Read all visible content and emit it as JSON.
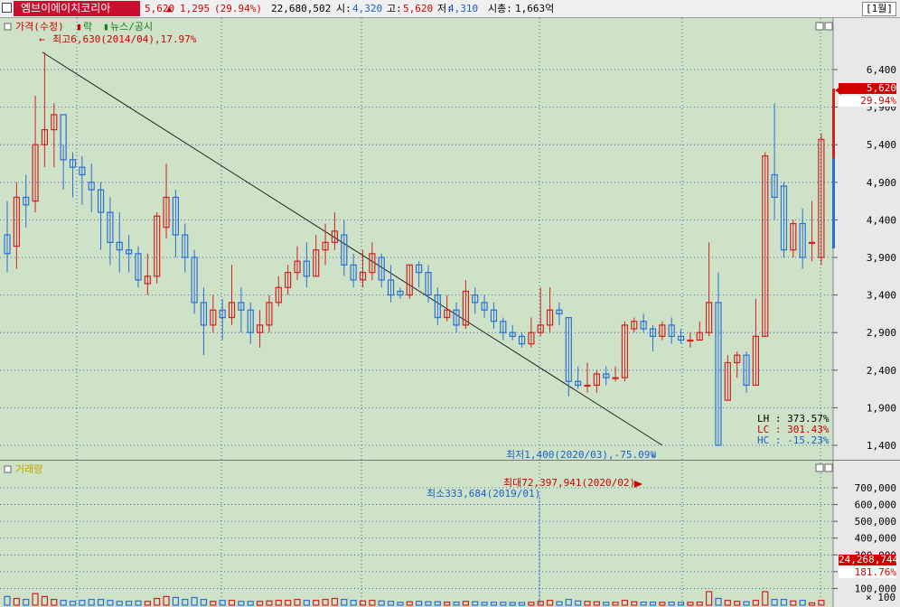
{
  "header": {
    "stock_name": "엠브이에이치코리아",
    "price": "5,620",
    "change": "1,295",
    "change_pct": "(29.94%)",
    "volume": "22,680,502",
    "open_label": "시:",
    "open_value": "4,320",
    "high_label": "고:",
    "high_value": "5,620",
    "low_label": "저:",
    "low_value": "4,310",
    "mcap_label": "시총:",
    "mcap_value": "1,663억",
    "period": "[1월]"
  },
  "price_pane": {
    "legend_price": "가격(수정)",
    "legend_fall": "락",
    "legend_news": "뉴스/공시",
    "max_annotation": "최고6,630(2014/04),17.97%",
    "min_annotation": "최저1,400(2020/03),-75.09%",
    "current_price_label": "5,620",
    "current_pct_label": "29.94%",
    "stats": [
      {
        "key": "LH",
        "value": "373.57%",
        "color": "#000000"
      },
      {
        "key": "LC",
        "value": "301.43%",
        "color": "#d00000"
      },
      {
        "key": "HC",
        "value": "-15.23%",
        "color": "#1a5fd0"
      }
    ]
  },
  "volume_pane": {
    "legend": "거래량",
    "max_annotation": "최대72,397,941(2020/02)",
    "min_annotation": "최소333,684(2019/01)",
    "current_volume_label": "24,268,744",
    "current_pct_label": "181.76%",
    "unit_label": "× 100"
  },
  "colors": {
    "bg": "#cde2c7",
    "up": "#d42020",
    "down": "#2a6fd6",
    "axis_bg": "#e8e8e8"
  },
  "chart_data": {
    "type": "candlestick",
    "y_axis_ticks": [
      "6,400",
      "5,900",
      "5,400",
      "4,900",
      "4,400",
      "3,900",
      "3,400",
      "2,900",
      "2,400",
      "1,900",
      "1,400"
    ],
    "volume_axis_ticks": [
      "700,000",
      "600,000",
      "500,000",
      "400,000",
      "300,000",
      "200,000",
      "100,000"
    ],
    "candles": [
      [
        4200,
        3950,
        4650,
        3700,
        45
      ],
      [
        4050,
        4700,
        4900,
        3750,
        35
      ],
      [
        4700,
        4600,
        5000,
        4300,
        30
      ],
      [
        4650,
        5400,
        6050,
        4500,
        60
      ],
      [
        5400,
        5600,
        6630,
        5100,
        45
      ],
      [
        5600,
        5800,
        5950,
        5100,
        30
      ],
      [
        5800,
        5200,
        5400,
        4800,
        25
      ],
      [
        5200,
        5100,
        5300,
        4700,
        20
      ],
      [
        5100,
        5000,
        5250,
        4600,
        25
      ],
      [
        4900,
        4800,
        5150,
        4500,
        30
      ],
      [
        4800,
        4500,
        4900,
        4000,
        30
      ],
      [
        4500,
        4100,
        4700,
        3800,
        25
      ],
      [
        4100,
        4000,
        4500,
        3700,
        20
      ],
      [
        4000,
        3950,
        4200,
        3700,
        20
      ],
      [
        3950,
        3600,
        4050,
        3500,
        22
      ],
      [
        3550,
        3650,
        3950,
        3400,
        20
      ],
      [
        3650,
        4450,
        4500,
        3550,
        35
      ],
      [
        4300,
        4700,
        5150,
        4150,
        45
      ],
      [
        4700,
        4200,
        4800,
        3900,
        40
      ],
      [
        4200,
        3900,
        4350,
        3700,
        30
      ],
      [
        3900,
        3300,
        4000,
        3150,
        40
      ],
      [
        3300,
        3000,
        3500,
        2600,
        30
      ],
      [
        3000,
        3200,
        3400,
        2900,
        20
      ],
      [
        3200,
        3100,
        3350,
        2800,
        25
      ],
      [
        3100,
        3300,
        3800,
        3000,
        25
      ],
      [
        3300,
        3200,
        3500,
        2900,
        20
      ],
      [
        3200,
        2900,
        3300,
        2750,
        20
      ],
      [
        2900,
        3000,
        3200,
        2700,
        20
      ],
      [
        3000,
        3300,
        3400,
        2900,
        22
      ],
      [
        3300,
        3500,
        3650,
        3250,
        25
      ],
      [
        3500,
        3700,
        3800,
        3400,
        25
      ],
      [
        3700,
        3850,
        4050,
        3600,
        30
      ],
      [
        3850,
        3650,
        4100,
        3500,
        25
      ],
      [
        3650,
        4000,
        4200,
        3650,
        25
      ],
      [
        4000,
        4100,
        4350,
        3800,
        30
      ],
      [
        4100,
        4250,
        4500,
        4000,
        35
      ],
      [
        4200,
        3800,
        4400,
        3650,
        30
      ],
      [
        3800,
        3600,
        3950,
        3500,
        25
      ],
      [
        3600,
        3700,
        4000,
        3500,
        22
      ],
      [
        3700,
        3950,
        4100,
        3600,
        25
      ],
      [
        3900,
        3600,
        3950,
        3500,
        22
      ],
      [
        3600,
        3400,
        3800,
        3300,
        20
      ],
      [
        3450,
        3400,
        3500,
        3350,
        15
      ],
      [
        3400,
        3800,
        3800,
        3350,
        18
      ],
      [
        3800,
        3700,
        3850,
        3500,
        20
      ],
      [
        3700,
        3400,
        3800,
        3300,
        18
      ],
      [
        3400,
        3100,
        3500,
        3000,
        18
      ],
      [
        3100,
        3200,
        3400,
        3050,
        16
      ],
      [
        3200,
        3000,
        3300,
        2900,
        16
      ],
      [
        3000,
        3450,
        3600,
        2950,
        20
      ],
      [
        3400,
        3300,
        3500,
        3150,
        18
      ],
      [
        3300,
        3200,
        3400,
        3100,
        15
      ],
      [
        3200,
        3050,
        3300,
        2950,
        15
      ],
      [
        3050,
        2900,
        3100,
        2800,
        15
      ],
      [
        2900,
        2850,
        3000,
        2800,
        14
      ],
      [
        2850,
        2750,
        2900,
        2700,
        14
      ],
      [
        2750,
        2900,
        3100,
        2700,
        15
      ],
      [
        2900,
        3000,
        3500,
        2850,
        20
      ],
      [
        3000,
        3200,
        3500,
        2900,
        25
      ],
      [
        3200,
        3150,
        3300,
        3000,
        18
      ],
      [
        3100,
        2250,
        3100,
        2050,
        30
      ],
      [
        2250,
        2200,
        2450,
        2150,
        22
      ],
      [
        2200,
        2200,
        2500,
        2100,
        20
      ],
      [
        2200,
        2350,
        2400,
        2100,
        18
      ],
      [
        2350,
        2300,
        2450,
        2200,
        15
      ],
      [
        2300,
        2300,
        2450,
        2250,
        15
      ],
      [
        2300,
        3000,
        3050,
        2250,
        25
      ],
      [
        2950,
        3050,
        3100,
        2900,
        18
      ],
      [
        3050,
        2950,
        3150,
        2900,
        16
      ],
      [
        2950,
        2850,
        3000,
        2650,
        16
      ],
      [
        2850,
        3000,
        3050,
        2800,
        15
      ],
      [
        3000,
        2850,
        3100,
        2750,
        16
      ],
      [
        2850,
        2800,
        2950,
        2750,
        15
      ],
      [
        2800,
        2800,
        2900,
        2700,
        15
      ],
      [
        2800,
        2900,
        3050,
        2800,
        16
      ],
      [
        2900,
        3300,
        4100,
        2850,
        70
      ],
      [
        3300,
        1400,
        3700,
        1400,
        35
      ],
      [
        2000,
        2500,
        2600,
        2000,
        25
      ],
      [
        2500,
        2600,
        2650,
        2300,
        20
      ],
      [
        2600,
        2200,
        2650,
        2100,
        18
      ],
      [
        2200,
        2850,
        3350,
        2200,
        25
      ],
      [
        2850,
        5250,
        5300,
        2850,
        70
      ],
      [
        5000,
        4700,
        5950,
        4400,
        30
      ],
      [
        4850,
        4000,
        4900,
        3900,
        30
      ],
      [
        4000,
        4350,
        4400,
        3900,
        22
      ],
      [
        4350,
        3900,
        4550,
        3750,
        25
      ],
      [
        4100,
        4100,
        4650,
        3850,
        12
      ],
      [
        3900,
        5470,
        5550,
        3800,
        25
      ]
    ]
  }
}
